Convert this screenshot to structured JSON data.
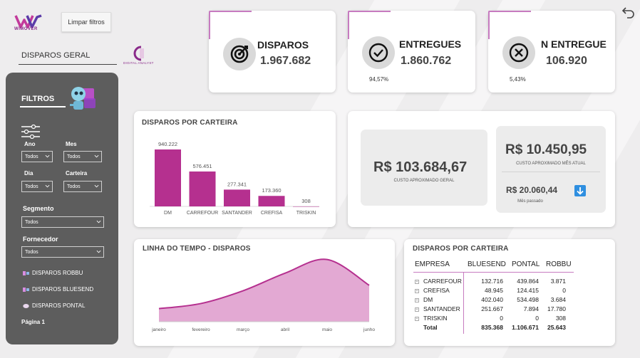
{
  "header": {
    "logo_text": "WiMOVER",
    "clear_filters_label": "Limpar filtros",
    "page_subtitle": "DISPAROS GERAL",
    "partner_logo_text": "DIGITAL ANALYST"
  },
  "filters": {
    "title": "FILTROS",
    "ano": {
      "label": "Ano",
      "value": "Todos"
    },
    "mes": {
      "label": "Mes",
      "value": "Todos"
    },
    "dia": {
      "label": "Dia",
      "value": "Todos"
    },
    "carteira": {
      "label": "Carteira",
      "value": "Todos"
    },
    "segmento": {
      "label": "Segmento",
      "value": "Todos"
    },
    "fornecedor": {
      "label": "Fornecedor",
      "value": "Todos"
    },
    "links": [
      "DISPAROS ROBBU",
      "DISPAROS BLUESEND",
      "DISPAROS PONTAL"
    ],
    "page_label": "Página 1"
  },
  "kpis": [
    {
      "label": "DISPAROS",
      "value": "1.967.682",
      "pct": "",
      "icon": "target-icon"
    },
    {
      "label": "ENTREGUES",
      "value": "1.860.762",
      "pct": "94,57%",
      "icon": "check-circle-icon"
    },
    {
      "label": "N ENTREGUE",
      "value": "106.920",
      "pct": "5,43%",
      "icon": "x-circle-icon"
    }
  ],
  "costs": {
    "general_value": "R$ 103.684,67",
    "general_label": "CUSTO APROXIMADO GERAL",
    "month_value": "R$ 10.450,95",
    "month_label": "CUSTO APROXIMADO MÊS ATUAL",
    "prev_value": "R$ 20.060,44",
    "prev_label": "Mês passado"
  },
  "colors": {
    "accent": "#b5308f",
    "area": "#e3a9d3",
    "line": "#b5308f"
  },
  "bar_chart": {
    "title": "DISPAROS POR CARTEIRA",
    "chart_data": {
      "type": "bar",
      "categories": [
        "DM",
        "CARREFOUR",
        "SANTANDER",
        "CREFISA",
        "TRISKIN"
      ],
      "values": [
        940222,
        576451,
        277341,
        173360,
        308
      ],
      "value_labels": [
        "940.222",
        "576.451",
        "277.341",
        "173.360",
        "308"
      ],
      "title": "DISPAROS POR CARTEIRA"
    }
  },
  "line_chart": {
    "title": "LINHA DO TEMPO - DISPAROS",
    "chart_data": {
      "type": "area",
      "categories": [
        "janeiro",
        "fevereiro",
        "março",
        "abril",
        "maio",
        "junho"
      ],
      "values": [
        43,
        60,
        102,
        160,
        205,
        120
      ],
      "ylim": [
        0,
        230
      ],
      "title": "LINHA DO TEMPO - DISPAROS"
    }
  },
  "table": {
    "title": "DISPAROS POR CARTEIRA",
    "columns": [
      "EMPRESA",
      "BLUESEND",
      "PONTAL",
      "ROBBU"
    ],
    "rows": [
      [
        "CARREFOUR",
        "132.716",
        "439.864",
        "3.871"
      ],
      [
        "CREFISA",
        "48.945",
        "124.415",
        "0"
      ],
      [
        "DM",
        "402.040",
        "534.498",
        "3.684"
      ],
      [
        "SANTANDER",
        "251.667",
        "7.894",
        "17.780"
      ],
      [
        "TRISKIN",
        "0",
        "0",
        "308"
      ]
    ],
    "total": [
      "Total",
      "835.368",
      "1.106.671",
      "25.643"
    ]
  }
}
